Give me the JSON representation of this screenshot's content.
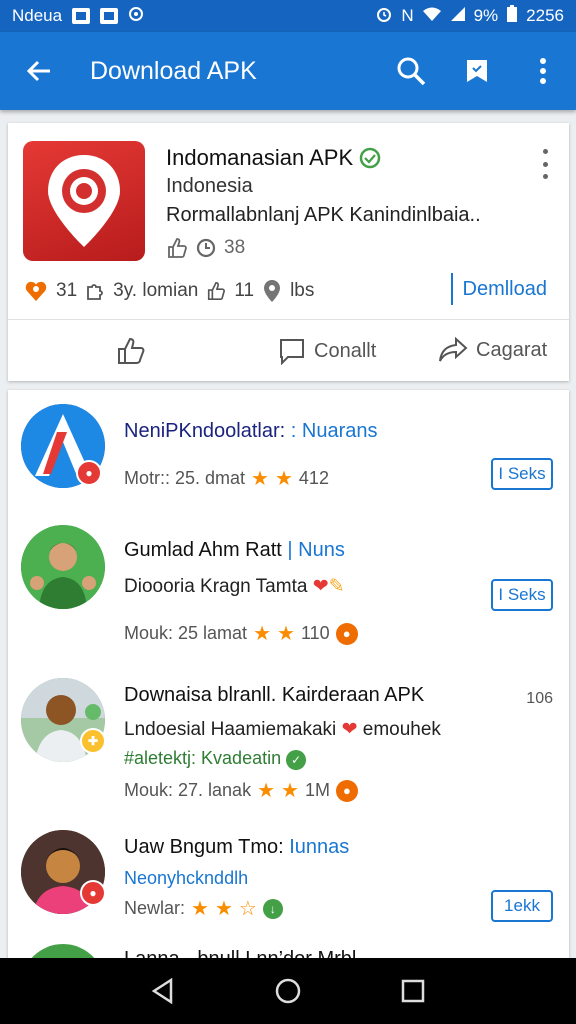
{
  "status_bar": {
    "left_text": "Ndeua",
    "n_label": "N",
    "battery": "9%",
    "time": "2256"
  },
  "app_bar": {
    "title": "Download APK"
  },
  "featured": {
    "name": "Indomanasian APK",
    "country": "Indonesia",
    "description": "Rormallabnlanj APK Kanindinlbaia..",
    "meta_count": "38",
    "stat_a": "31",
    "stat_b": "3y. lomian",
    "stat_c": "11",
    "stat_d": "lbs",
    "download_label": "Demlload",
    "actions": {
      "like": "",
      "comment": "Conallt",
      "share": "Cagarat"
    },
    "colors": {
      "icon_bg": "#d32f2f",
      "verified": "#43a047"
    }
  },
  "list": {
    "items": [
      {
        "title": "NeniPKndoolatlar: ",
        "tag": ": Nuarans",
        "meta_prefix": "Motr:: 25. dmat",
        "meta_suffix": "412",
        "button": "I Seks",
        "rating": 2
      },
      {
        "title": "Gumlad Ahm Ratt",
        "tag": "| Nuns",
        "line": "Dioooria Kragn Tamta",
        "meta_prefix": "Mouk: 25 lamat",
        "meta_suffix": "110",
        "button": "I Seks",
        "rating": 2
      },
      {
        "title": "Downaisa blranll. Kairderaan APK",
        "right_count": "106",
        "line": "Lndoesial Haamiemakaki",
        "line_suffix": "emouhek",
        "line2": "#aletektj: Kvadeatin",
        "meta_prefix": "Mouk: 27. lanak",
        "meta_suffix": "1M",
        "rating": 2
      },
      {
        "title": "Uaw Bngum Tmo:",
        "tag": "Iunnas",
        "line": "Neonyhcknddlh",
        "meta_prefix": "Newlar:",
        "button": "1ekk",
        "rating": 2.5
      },
      {
        "title": "Lanna · bnull Lnn’dor Mrbl"
      }
    ]
  }
}
